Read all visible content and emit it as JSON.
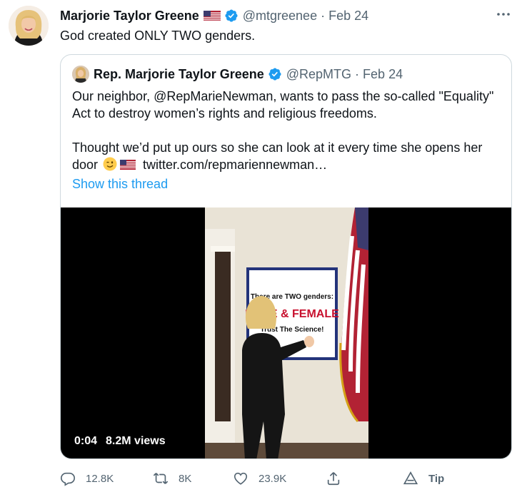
{
  "author": {
    "name": "Marjorie Taylor Greene",
    "flag_icon": "us-flag-icon",
    "verified_icon": "verified-badge-icon",
    "handle": "@mtgreenee",
    "separator": "·",
    "date": "Feb 24"
  },
  "more_icon": "more-options-icon",
  "tweet": {
    "text": "God created ONLY TWO genders."
  },
  "quote": {
    "name": "Rep. Marjorie Taylor Greene",
    "handle": "@RepMTG",
    "separator": "·",
    "date": "Feb 24",
    "para1": "Our neighbor, @RepMarieNewman, wants to pass the so-called \"Equality\" Act to destroy women’s rights and religious freedoms.",
    "para2_text": "Thought we’d put up ours so she can look at it every time she opens her door",
    "para2_emoji": [
      "winking-face-emoji",
      "us-flag-emoji"
    ],
    "para2_link": "twitter.com/repmariennewman…",
    "show_thread": "Show this thread",
    "video": {
      "sign_line1": "There are TWO genders:",
      "sign_line2": "MALE & FEMALE",
      "sign_line3": "Trust The Science!",
      "time": "0:04",
      "views": "8.2M views"
    }
  },
  "actions": {
    "reply_count": "12.8K",
    "retweet_count": "8K",
    "like_count": "23.9K",
    "tip_label": "Tip"
  },
  "colors": {
    "link_blue": "#1d9bf0",
    "muted": "#536471",
    "text": "#0f1419",
    "border": "#cfd9de"
  }
}
